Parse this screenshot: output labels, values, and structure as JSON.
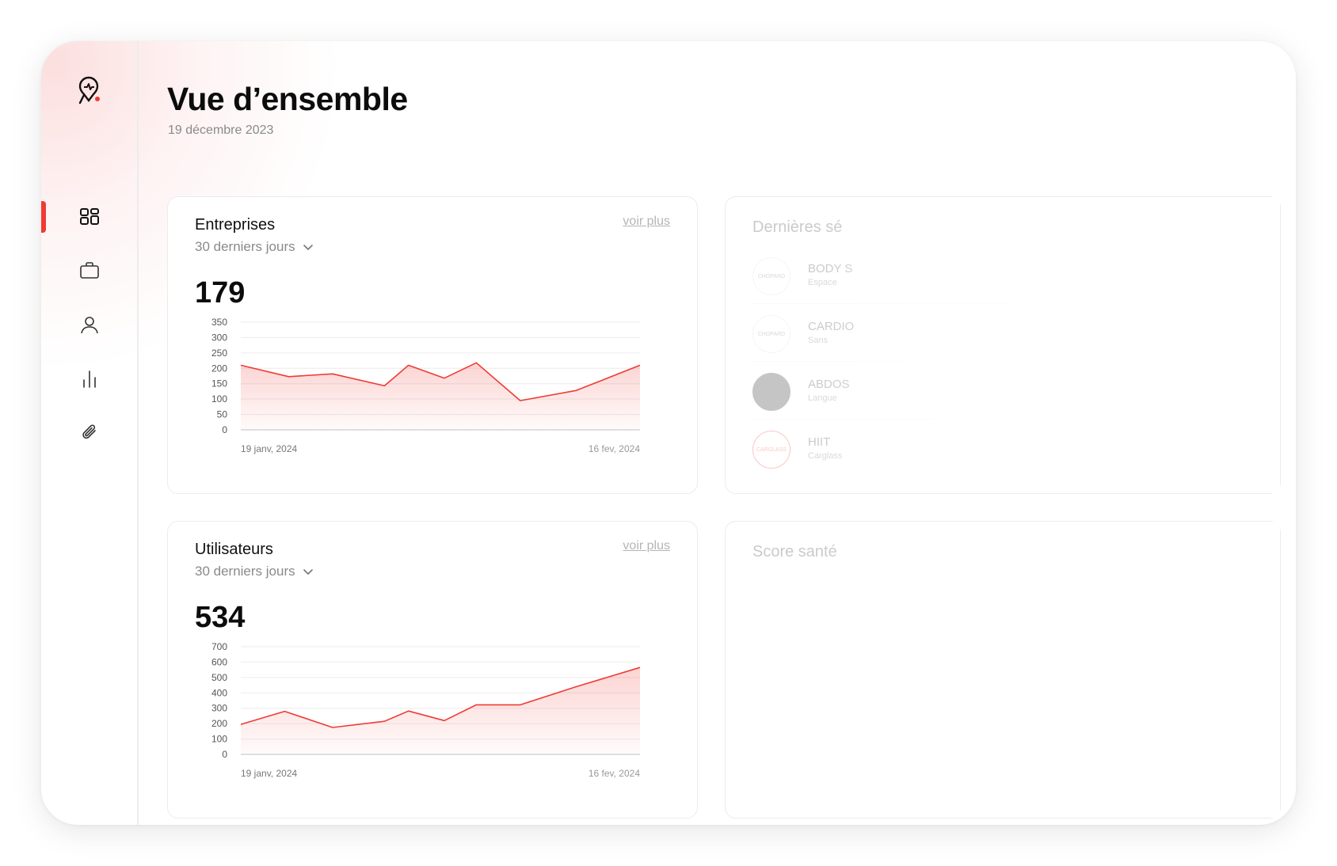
{
  "header": {
    "title": "Vue d’ensemble",
    "date": "19 décembre 2023"
  },
  "sidebar": {
    "items": [
      {
        "icon": "dashboard-grid-icon",
        "active": true
      },
      {
        "icon": "briefcase-icon",
        "active": false
      },
      {
        "icon": "user-icon",
        "active": false
      },
      {
        "icon": "bar-chart-icon",
        "active": false
      },
      {
        "icon": "paperclip-icon",
        "active": false
      }
    ]
  },
  "colors": {
    "accent": "#ef3b34",
    "fill_light": "#fbe0df"
  },
  "cards": {
    "entreprises": {
      "title": "Entreprises",
      "link": "voir plus",
      "period": "30 derniers jours",
      "value": "179"
    },
    "utilisateurs": {
      "title": "Utilisateurs",
      "link": "voir plus",
      "period": "30 derniers jours",
      "value": "534"
    },
    "sessions": {
      "title": "Dernières sé",
      "items": [
        {
          "name": "BODY S",
          "sub": "Espace",
          "logo_text": "CHOPARD"
        },
        {
          "name": "CARDIO",
          "sub": "Sans",
          "logo_text": "CHOPARD"
        },
        {
          "name": "ABDOS",
          "sub": "Langue",
          "logo_text": ""
        },
        {
          "name": "HIIT",
          "sub": "Carglass",
          "logo_text": "CARGLASS"
        }
      ]
    },
    "score": {
      "title": "Score santé"
    }
  },
  "chart_data": [
    {
      "type": "area",
      "x_start_label": "19 janv, 2024",
      "x_end_label": "16 fev, 2024",
      "y_ticks": [
        0,
        50,
        100,
        150,
        200,
        250,
        300,
        350
      ],
      "ylim": [
        0,
        350
      ],
      "values": [
        210,
        173,
        182,
        143,
        210,
        168,
        218,
        95,
        128,
        210
      ],
      "x_positions": [
        0,
        0.12,
        0.23,
        0.36,
        0.42,
        0.51,
        0.59,
        0.7,
        0.84,
        1.0
      ]
    },
    {
      "type": "area",
      "x_start_label": "19 janv, 2024",
      "x_end_label": "16 fev, 2024",
      "y_ticks": [
        0,
        100,
        200,
        300,
        400,
        500,
        600,
        700
      ],
      "ylim": [
        0,
        700
      ],
      "values": [
        195,
        280,
        175,
        215,
        282,
        220,
        322,
        322,
        440,
        565
      ],
      "x_positions": [
        0,
        0.11,
        0.23,
        0.36,
        0.42,
        0.51,
        0.59,
        0.7,
        0.84,
        1.0
      ]
    }
  ]
}
